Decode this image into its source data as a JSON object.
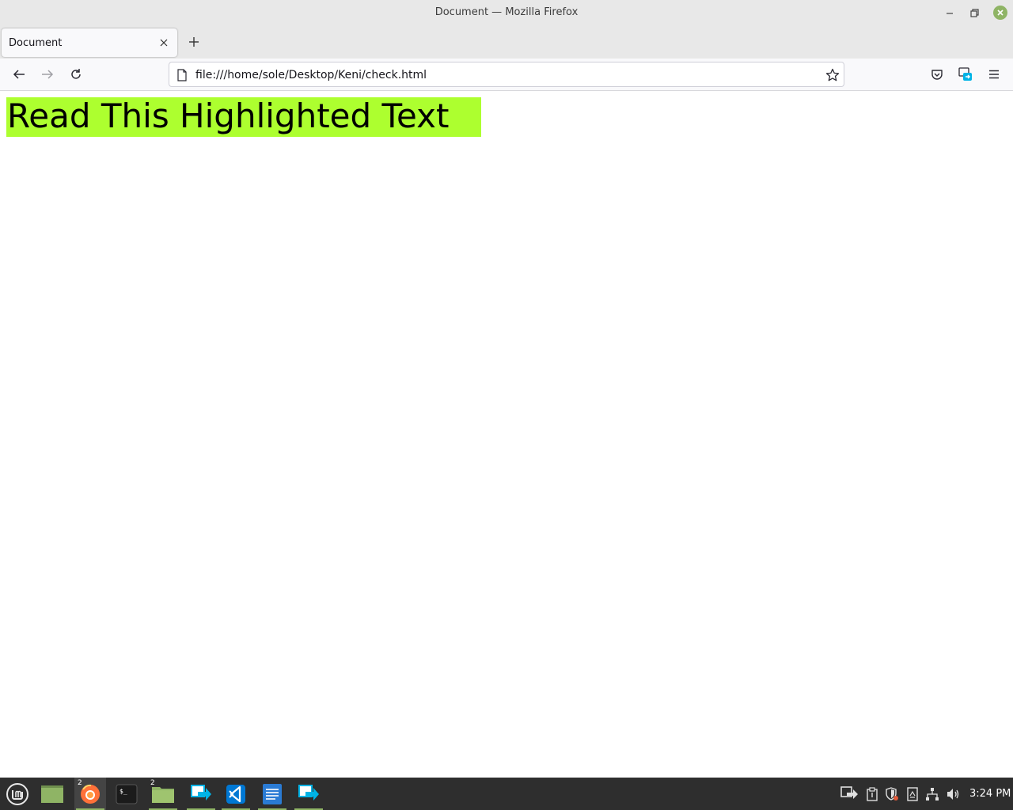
{
  "window": {
    "title": "Document — Mozilla Firefox"
  },
  "tabs": [
    {
      "title": "Document",
      "active": true
    }
  ],
  "navbar": {
    "url": "file:///home/sole/Desktop/Keni/check.html"
  },
  "page": {
    "highlight_text": "Read This Highlighted Text",
    "highlight_color": "#adff2f"
  },
  "taskbar": {
    "items": [
      {
        "name": "mint-menu-icon"
      },
      {
        "name": "show-desktop-icon"
      },
      {
        "name": "firefox-icon",
        "badge": "2",
        "active": true
      },
      {
        "name": "terminal-icon",
        "glyph": "$_"
      },
      {
        "name": "files-folder-icon",
        "badge": "2"
      },
      {
        "name": "app-arrow-icon"
      },
      {
        "name": "vscode-icon"
      },
      {
        "name": "text-editor-icon"
      },
      {
        "name": "app-arrow-icon"
      }
    ],
    "clock": "3:24 PM"
  }
}
